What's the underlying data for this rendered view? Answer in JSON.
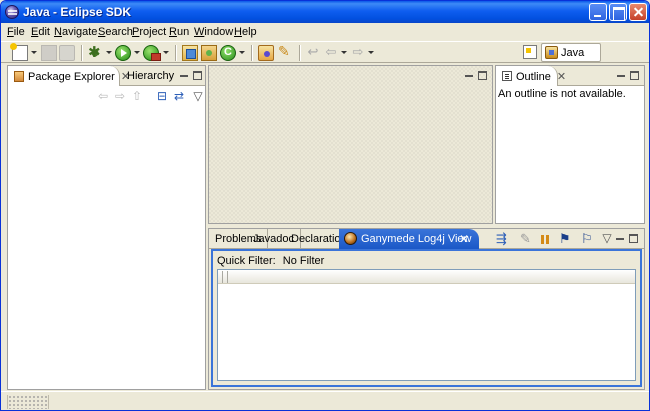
{
  "window": {
    "title": "Java - Eclipse SDK"
  },
  "menu": {
    "items": [
      "File",
      "Edit",
      "Navigate",
      "Search",
      "Project",
      "Run",
      "Window",
      "Help"
    ]
  },
  "perspective": {
    "active_label": "Java"
  },
  "package_explorer": {
    "tab_label": "Package Explorer",
    "tab_close": "✕",
    "secondary_tab_label": "Hierarchy"
  },
  "outline": {
    "tab_label": "Outline",
    "tab_close": "✕",
    "message": "An outline is not available."
  },
  "bottom_panel": {
    "tabs": [
      "Problems",
      "Javadoc",
      "Declaration"
    ],
    "active_tab_label": "Ganymede Log4j View",
    "active_tab_close": "✕",
    "quick_filter_label": "Quick Filter:",
    "quick_filter_value": "No Filter"
  },
  "colors": {
    "title_bar": "#0A58E8",
    "active_tab": "#3A74D9",
    "chrome": "#ECE9D8"
  }
}
